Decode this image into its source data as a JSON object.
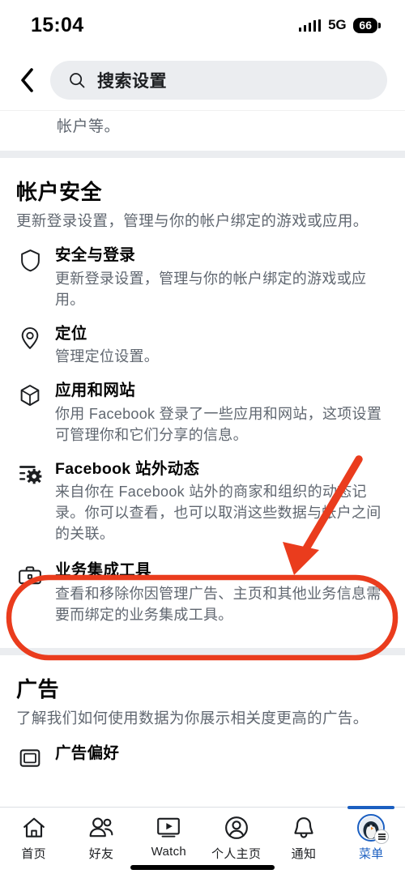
{
  "status_bar": {
    "time": "15:04",
    "network": "5G",
    "battery": "66",
    "signal_icon": "signal-bars-icon",
    "battery_icon": "battery-icon"
  },
  "header": {
    "back_icon": "chevron-left-icon",
    "search_icon": "search-icon",
    "search_value": "搜索设置"
  },
  "scroll_top_fragment": "帐户等。",
  "sections": [
    {
      "title": "帐户安全",
      "description": "更新登录设置，管理与你的帐户绑定的游戏或应用。",
      "items": [
        {
          "icon": "shield-icon",
          "title": "安全与登录",
          "description": "更新登录设置，管理与你的帐户绑定的游戏或应用。",
          "highlighted": false
        },
        {
          "icon": "location-pin-icon",
          "title": "定位",
          "description": "管理定位设置。",
          "highlighted": false
        },
        {
          "icon": "cube-icon",
          "title": "应用和网站",
          "description": "你用 Facebook 登录了一些应用和网站，这项设置可管理你和它们分享的信息。",
          "highlighted": false
        },
        {
          "icon": "sliders-gear-icon",
          "title": "Facebook 站外动态",
          "description": "来自你在 Facebook 站外的商家和组织的动态记录。你可以查看，也可以取消这些数据与帐户之间的关联。",
          "highlighted": false
        },
        {
          "icon": "briefcase-icon",
          "title": "业务集成工具",
          "description": "查看和移除你因管理广告、主页和其他业务信息需要而绑定的业务集成工具。",
          "highlighted": true
        }
      ]
    },
    {
      "title": "广告",
      "description": "了解我们如何使用数据为你展示相关度更高的广告。",
      "items": [
        {
          "icon": "window-icon",
          "title": "广告偏好",
          "description": "",
          "highlighted": false
        }
      ]
    }
  ],
  "annotation": {
    "color": "#ea3c1d",
    "arrow_icon": "arrow-down-left-icon",
    "highlight_icon": "rounded-rect-highlight"
  },
  "tabbar": {
    "items": [
      {
        "label": "首页",
        "icon": "home-icon",
        "active": false
      },
      {
        "label": "好友",
        "icon": "friends-icon",
        "active": false
      },
      {
        "label": "Watch",
        "icon": "watch-icon",
        "active": false
      },
      {
        "label": "个人主页",
        "icon": "profile-icon",
        "active": false
      },
      {
        "label": "通知",
        "icon": "bell-icon",
        "active": false
      },
      {
        "label": "菜单",
        "icon": "menu-avatar-icon",
        "active": true
      }
    ],
    "active_color": "#1b5fc1"
  }
}
